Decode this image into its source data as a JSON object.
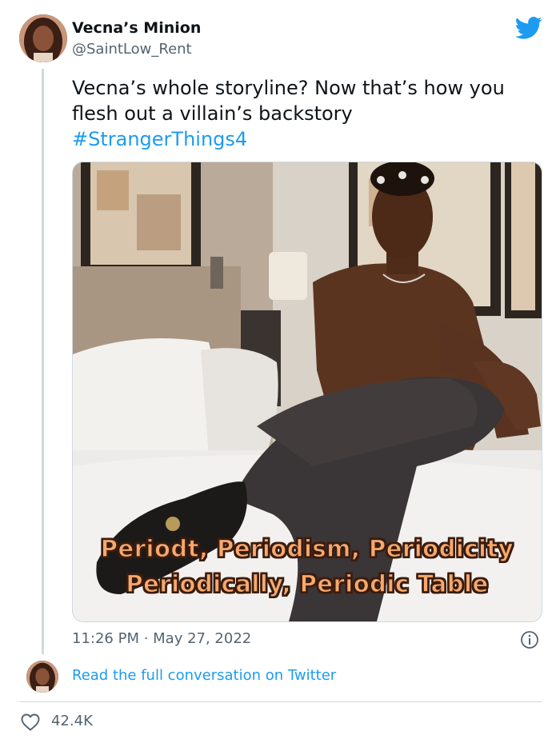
{
  "author": {
    "name": "Vecna’s Minion",
    "handle": "@SaintLow_Rent"
  },
  "tweet": {
    "text_line_1": "Vecna’s whole storyline? Now that’s how you",
    "text_line_2": "flesh out a villain’s backstory",
    "hashtag": "#StrangerThings4",
    "media_caption_line_1": "Periodt, Periodism, Periodicity",
    "media_caption_line_2": "Periodically, Periodic Table",
    "timestamp": "11:26 PM · May 27, 2022"
  },
  "footer": {
    "read_link": "Read the full conversation on Twitter",
    "like_count": "42.4K"
  },
  "icons": {
    "brand": "twitter-bird-icon",
    "info": "info-icon",
    "like": "heart-icon"
  },
  "colors": {
    "brand_blue": "#1d9bf0",
    "text_primary": "#0f1419",
    "text_secondary": "#536471",
    "border": "#cfd9de"
  }
}
